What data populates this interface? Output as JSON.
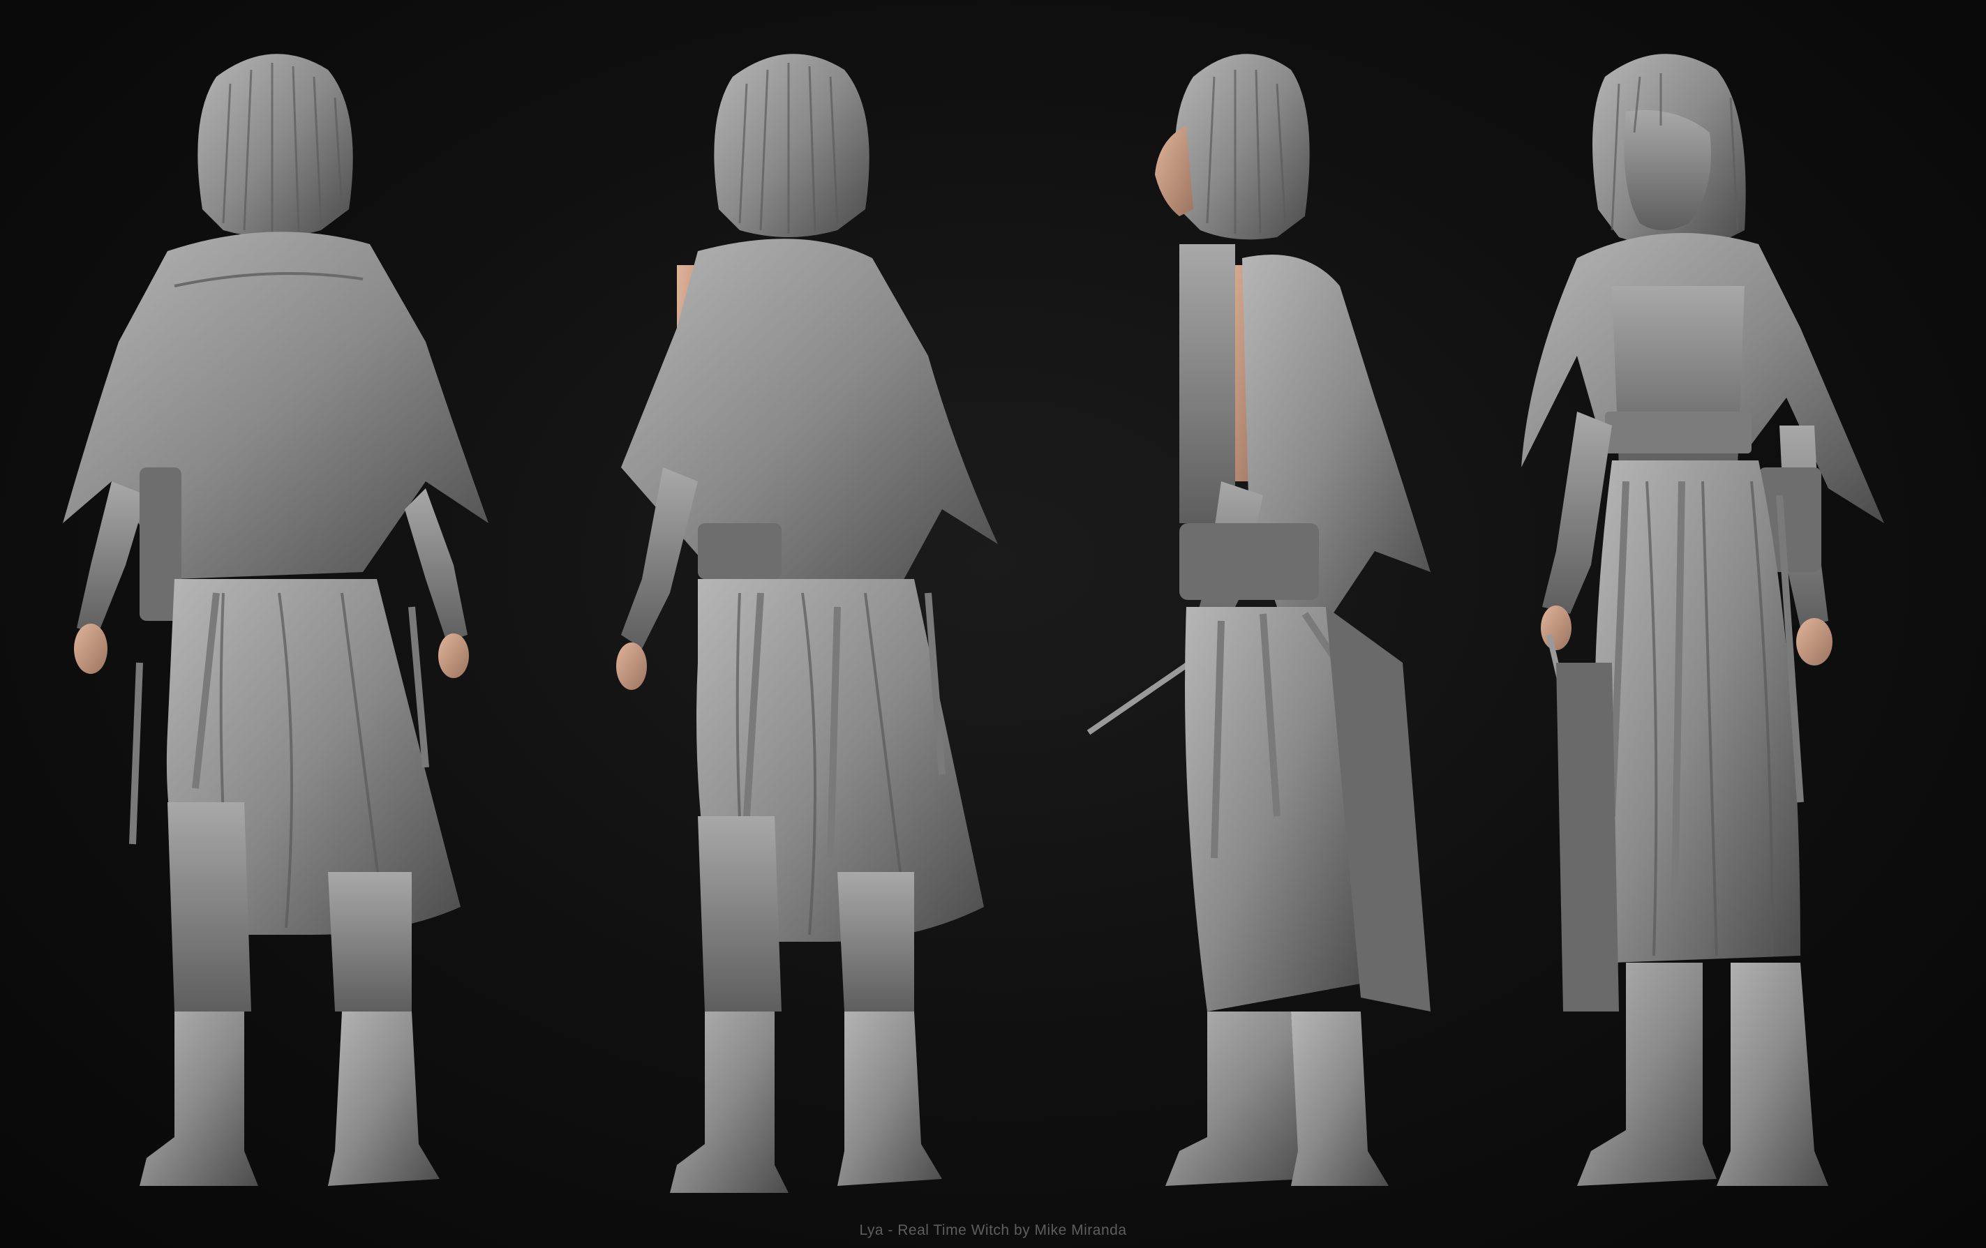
{
  "caption": "Lya - Real Time Witch by Mike Miranda",
  "colors": {
    "background": "#0b0b0b",
    "clay": "#8a8a8a",
    "clay_dark": "#5a5a5a",
    "clay_light": "#b4b4b4",
    "skin": "#c89c82",
    "caption": "#5e5e5e"
  },
  "views": [
    {
      "name": "back-view"
    },
    {
      "name": "back-three-quarter-view"
    },
    {
      "name": "side-view"
    },
    {
      "name": "front-three-quarter-view"
    }
  ]
}
